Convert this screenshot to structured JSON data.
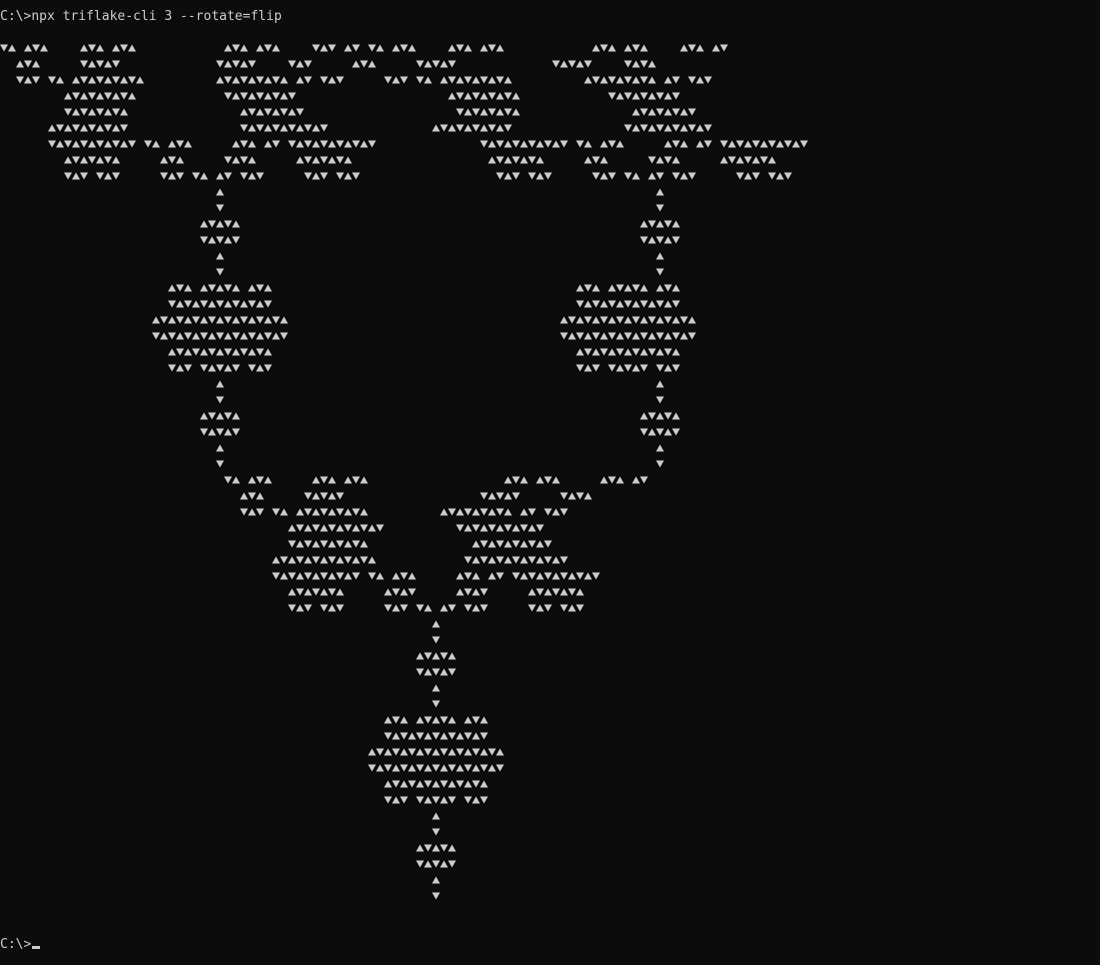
{
  "console": {
    "command_prompt": "C:\\>",
    "command": "npx triflake-cli 3 --rotate=flip",
    "final_prompt": "C:\\>"
  },
  "colors": {
    "background": "#0c0c0c",
    "foreground": "#cccccc"
  },
  "art": {
    "lines": [
      "▼▲ ▲▼▲    ▲▼▲ ▲▼▲           ▲▼▲ ▲▼▲    ▼▲▼ ▲▼ ▼▲ ▲▼▲    ▲▼▲ ▲▼▲           ▲▼▲ ▲▼▲    ▲▼▲ ▲▼",
      "  ▲▼▲     ▼▲▼▲▼            ▼▲▼▲▼    ▼▲▼     ▲▼▲     ▼▲▼▲▼            ▼▲▼▲▼    ▼▲▼▲",
      "  ▼▲▼ ▼▲ ▲▼▲▼▲▼▲▼▲         ▲▼▲▼▲▼▲▼▲ ▲▼ ▼▲▼     ▼▲▼ ▼▲ ▲▼▲▼▲▼▲▼▲         ▲▼▲▼▲▼▲▼▲ ▲▼ ▼▲▼",
      "        ▲▼▲▼▲▼▲▼▲           ▼▲▼▲▼▲▼▲▼                   ▲▼▲▼▲▼▲▼▲           ▼▲▼▲▼▲▼▲▼",
      "        ▼▲▼▲▼▲▼▲              ▲▼▲▼▲▼▲▼                   ▼▲▼▲▼▲▼▲              ▲▼▲▼▲▼▲▼",
      "      ▲▼▲▼▲▼▲▼▲▼              ▼▲▼▲▼▲▼▲▼▲▼             ▲▼▲▼▲▼▲▼▲▼              ▼▲▼▲▼▲▼▲▼▲▼",
      "      ▼▲▼▲▼▲▼▲▼▲▼ ▼▲ ▲▼▲     ▲▼▲ ▲▼ ▼▲▼▲▼▲▼▲▼▲▼             ▼▲▼▲▼▲▼▲▼▲▼ ▼▲ ▲▼▲     ▲▼▲ ▲▼ ▼▲▼▲▼▲▼▲▼▲▼",
      "        ▲▼▲▼▲▼▲     ▲▼▲     ▼▲▼▲     ▲▼▲▼▲▼▲                 ▲▼▲▼▲▼▲     ▲▼▲     ▼▲▼▲     ▲▼▲▼▲▼▲",
      "        ▼▲▼ ▼▲▼     ▼▲▼ ▼▲ ▲▼ ▼▲▼     ▼▲▼ ▼▲▼                 ▼▲▼ ▼▲▼     ▼▲▼ ▼▲ ▲▼ ▼▲▼     ▼▲▼ ▼▲▼",
      "                           ▲                                                      ▲",
      "                           ▼                                                      ▼",
      "                         ▲▼▲▼▲                                                  ▲▼▲▼▲",
      "                         ▼▲▼▲▼                                                  ▼▲▼▲▼",
      "                           ▲                                                      ▲",
      "                           ▼                                                      ▼",
      "                     ▲▼▲ ▲▼▲▼▲ ▲▼▲                                      ▲▼▲ ▲▼▲▼▲ ▲▼▲",
      "                     ▼▲▼▲▼▲▼▲▼▲▼▲▼                                      ▼▲▼▲▼▲▼▲▼▲▼▲▼",
      "                   ▲▼▲▼▲▼▲▼▲▼▲▼▲▼▲▼▲                                  ▲▼▲▼▲▼▲▼▲▼▲▼▲▼▲▼▲",
      "                   ▼▲▼▲▼▲▼▲▼▲▼▲▼▲▼▲▼                                  ▼▲▼▲▼▲▼▲▼▲▼▲▼▲▼▲▼",
      "                     ▲▼▲▼▲▼▲▼▲▼▲▼▲                                      ▲▼▲▼▲▼▲▼▲▼▲▼▲",
      "                     ▼▲▼ ▼▲▼▲▼ ▼▲▼                                      ▼▲▼ ▼▲▼▲▼ ▼▲▼",
      "                           ▲                                                      ▲",
      "                           ▼                                                      ▼",
      "                         ▲▼▲▼▲                                                  ▲▼▲▼▲",
      "                         ▼▲▼▲▼                                                  ▼▲▼▲▼",
      "                           ▲                                                      ▲",
      "                           ▼                                                      ▼",
      "                            ▼▲ ▲▼▲     ▲▼▲ ▲▼▲                 ▲▼▲ ▲▼▲     ▲▼▲ ▲▼",
      "                              ▲▼▲     ▼▲▼▲▼                 ▼▲▼▲▼     ▼▲▼▲",
      "                              ▼▲▼ ▼▲ ▲▼▲▼▲▼▲▼▲         ▲▼▲▼▲▼▲▼▲ ▲▼ ▼▲▼",
      "                                    ▲▼▲▼▲▼▲▼▲▼▲▼         ▼▲▼▲▼▲▼▲▼▲▼",
      "                                    ▼▲▼▲▼▲▼▲▼▲             ▲▼▲▼▲▼▲▼▲▼",
      "                                  ▲▼▲▼▲▼▲▼▲▼▲▼▲           ▼▲▼▲▼▲▼▲▼▲▼▲▼",
      "                                  ▼▲▼▲▼▲▼▲▼▲▼ ▼▲ ▲▼▲     ▲▼▲ ▲▼ ▼▲▼▲▼▲▼▲▼▲▼",
      "                                    ▲▼▲▼▲▼▲     ▲▼▲▼     ▲▼▲▼     ▲▼▲▼▲▼▲",
      "                                    ▼▲▼ ▼▲▼     ▼▲▼ ▼▲ ▲▼ ▼▲▼     ▼▲▼ ▼▲▼",
      "                                                      ▲",
      "                                                      ▼",
      "                                                    ▲▼▲▼▲",
      "                                                    ▼▲▼▲▼",
      "                                                      ▲",
      "                                                      ▼",
      "                                                ▲▼▲ ▲▼▲▼▲ ▲▼▲",
      "                                                ▼▲▼▲▼▲▼▲▼▲▼▲▼",
      "                                              ▲▼▲▼▲▼▲▼▲▼▲▼▲▼▲▼▲",
      "                                              ▼▲▼▲▼▲▼▲▼▲▼▲▼▲▼▲▼",
      "                                                ▲▼▲▼▲▼▲▼▲▼▲▼▲",
      "                                                ▼▲▼ ▼▲▼▲▼ ▼▲▼",
      "                                                      ▲",
      "                                                      ▼",
      "                                                    ▲▼▲▼▲",
      "                                                    ▼▲▼▲▼",
      "                                                      ▲",
      "                                                      ▼"
    ]
  }
}
